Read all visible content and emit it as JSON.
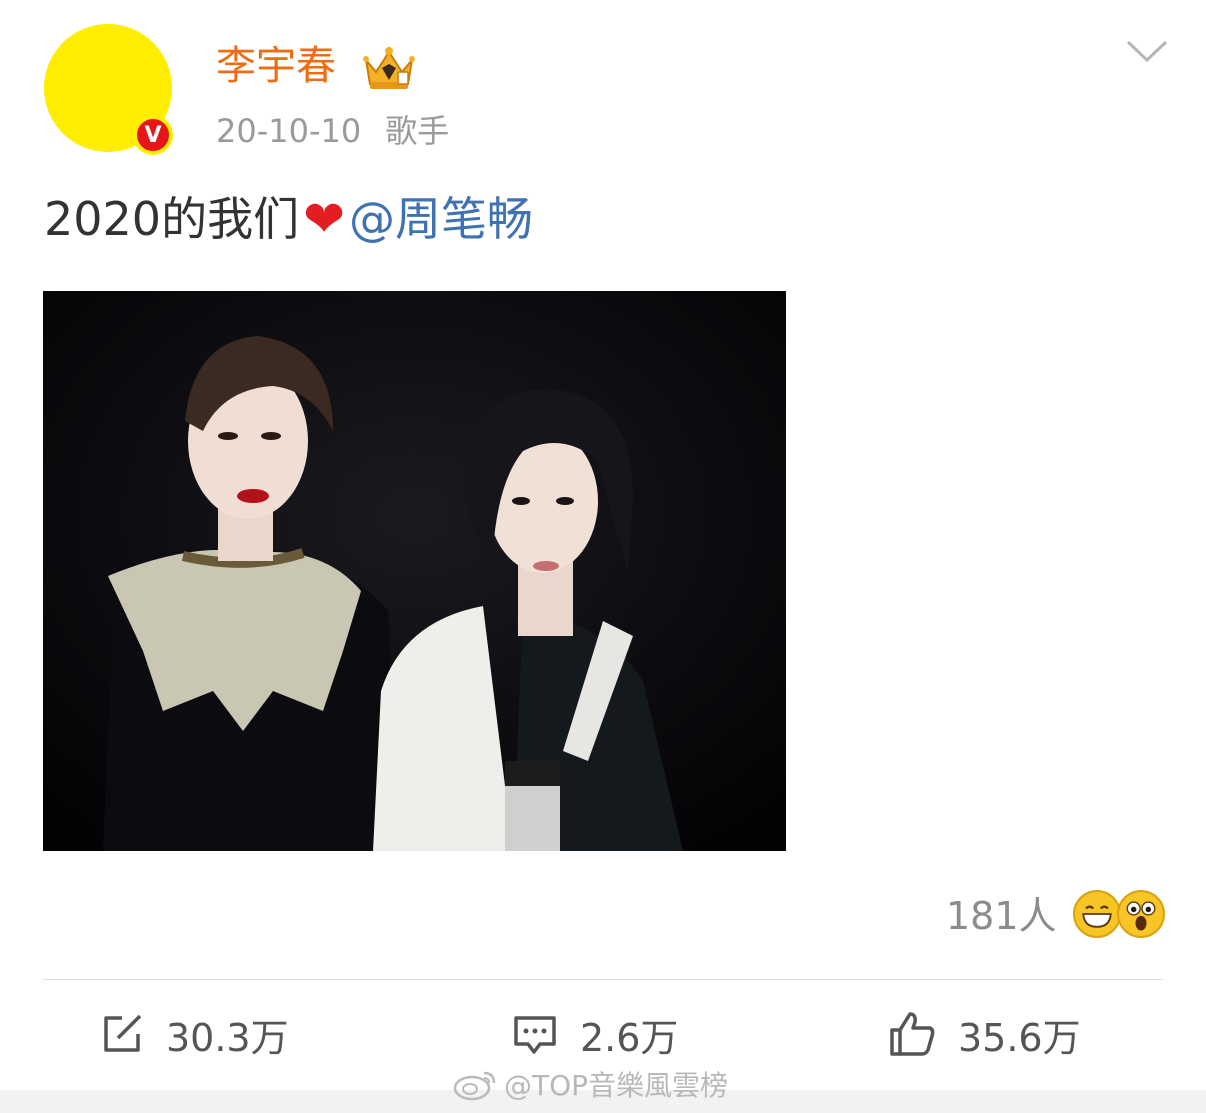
{
  "post": {
    "author": "李宇春",
    "date": "20-10-10",
    "source": "歌手",
    "text": "2020的我们",
    "heart": "❤",
    "mention": "@周笔畅"
  },
  "reactions": {
    "count": "181人"
  },
  "actions": {
    "repost": "30.3万",
    "comment": "2.6万",
    "like": "35.6万"
  },
  "watermark": "@TOP音樂風雲榜",
  "icons": {
    "verified_badge": "V",
    "crown": "vip-crown-icon",
    "menu": "chevron-down-icon"
  },
  "colors": {
    "username": "#f06c12",
    "mention": "#3f72b0",
    "badge": "#e8161a",
    "avatar": "#ffee00"
  }
}
